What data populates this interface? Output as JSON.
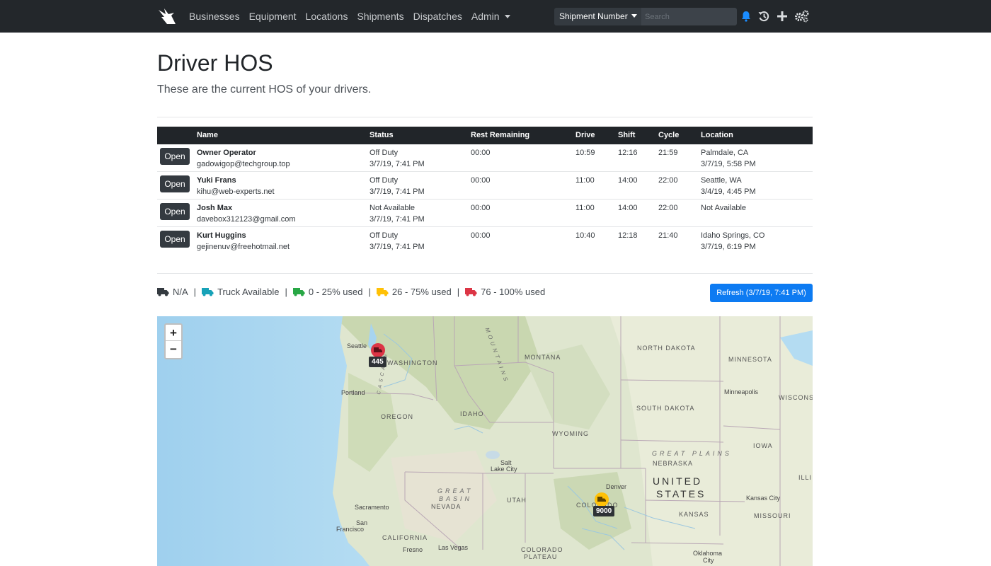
{
  "nav": {
    "links": [
      "Businesses",
      "Equipment",
      "Locations",
      "Shipments",
      "Dispatches"
    ],
    "admin_label": "Admin",
    "search_type": "Shipment Number",
    "search_placeholder": "Search"
  },
  "page": {
    "title": "Driver HOS",
    "subtitle": "These are the current HOS of your drivers."
  },
  "table": {
    "headers": [
      "Name",
      "Status",
      "Rest Remaining",
      "Drive",
      "Shift",
      "Cycle",
      "Location"
    ],
    "open_label": "Open",
    "rows": [
      {
        "name": "Owner Operator",
        "email": "gadowigop@techgroup.top",
        "status": "Off Duty",
        "status_time": "3/7/19, 7:41 PM",
        "rest": "00:00",
        "drive": "10:59",
        "shift": "12:16",
        "cycle": "21:59",
        "location": "Palmdale, CA",
        "location_time": "3/7/19, 5:58 PM"
      },
      {
        "name": "Yuki Frans",
        "email": "kihu@web-experts.net",
        "status": "Off Duty",
        "status_time": "3/7/19, 7:41 PM",
        "rest": "00:00",
        "drive": "11:00",
        "shift": "14:00",
        "cycle": "22:00",
        "location": "Seattle, WA",
        "location_time": "3/4/19, 4:45 PM"
      },
      {
        "name": "Josh Max",
        "email": "davebox312123@gmail.com",
        "status": "Not Available",
        "status_time": "3/7/19, 7:41 PM",
        "rest": "00:00",
        "drive": "11:00",
        "shift": "14:00",
        "cycle": "22:00",
        "location": "Not Available",
        "location_time": ""
      },
      {
        "name": "Kurt Huggins",
        "email": "gejinenuv@freehotmail.net",
        "status": "Off Duty",
        "status_time": "3/7/19, 7:41 PM",
        "rest": "00:00",
        "drive": "10:40",
        "shift": "12:18",
        "cycle": "21:40",
        "location": "Idaho Springs, CO",
        "location_time": "3/7/19, 6:19 PM"
      }
    ]
  },
  "legend": {
    "items": [
      {
        "label": "N/A",
        "color": "#343a40"
      },
      {
        "label": "Truck Available",
        "color": "#17a2b8"
      },
      {
        "label": "0 - 25% used",
        "color": "#28a745"
      },
      {
        "label": "26 - 75% used",
        "color": "#ffc107"
      },
      {
        "label": "76 - 100% used",
        "color": "#dc3545"
      }
    ],
    "separator": "|"
  },
  "refresh_label": "Refresh (3/7/19, 7:41 PM)",
  "map": {
    "zoom_in": "+",
    "zoom_out": "−",
    "labels": {
      "seattle": "Seattle",
      "washington": "WASHINGTON",
      "portland": "Portland",
      "oregon": "OREGON",
      "idaho": "IDAHO",
      "montana": "MONTANA",
      "wyoming": "WYOMING",
      "north_dakota": "NORTH DAKOTA",
      "south_dakota": "SOUTH DAKOTA",
      "minnesota": "MINNESOTA",
      "minneapolis": "Minneapolis",
      "wisconsin": "WISCONSI",
      "iowa": "IOWA",
      "nebraska": "NEBRASKA",
      "great_plains": "GREAT PLAINS",
      "salt_lake": "Salt",
      "salt_lake_2": "Lake City",
      "great_basin": "GREAT",
      "great_basin_2": "BASIN",
      "nevada": "NEVADA",
      "utah": "UTAH",
      "colorado": "COLORADO",
      "denver": "Denver",
      "united": "UNITED",
      "states": "STATES",
      "kansas": "KANSAS",
      "kansas_city": "Kansas City",
      "missouri": "MISSOURI",
      "sacramento": "Sacramento",
      "san": "San",
      "francisco": "Francisco",
      "california": "CALIFORNIA",
      "fresno": "Fresno",
      "las_vegas": "Las Vegas",
      "colorado_plateau": "COLORADO",
      "colorado_plateau_2": "PLATEAU",
      "oklahoma": "Oklahoma",
      "oklahoma_city": "City",
      "mountains": "MOUNTAINS",
      "cascade": "CASCADE",
      "illinois": "ILLI"
    },
    "markers": [
      {
        "label": "445",
        "color": "#dc3545"
      },
      {
        "label": "9000",
        "color": "#ffc107"
      }
    ]
  }
}
